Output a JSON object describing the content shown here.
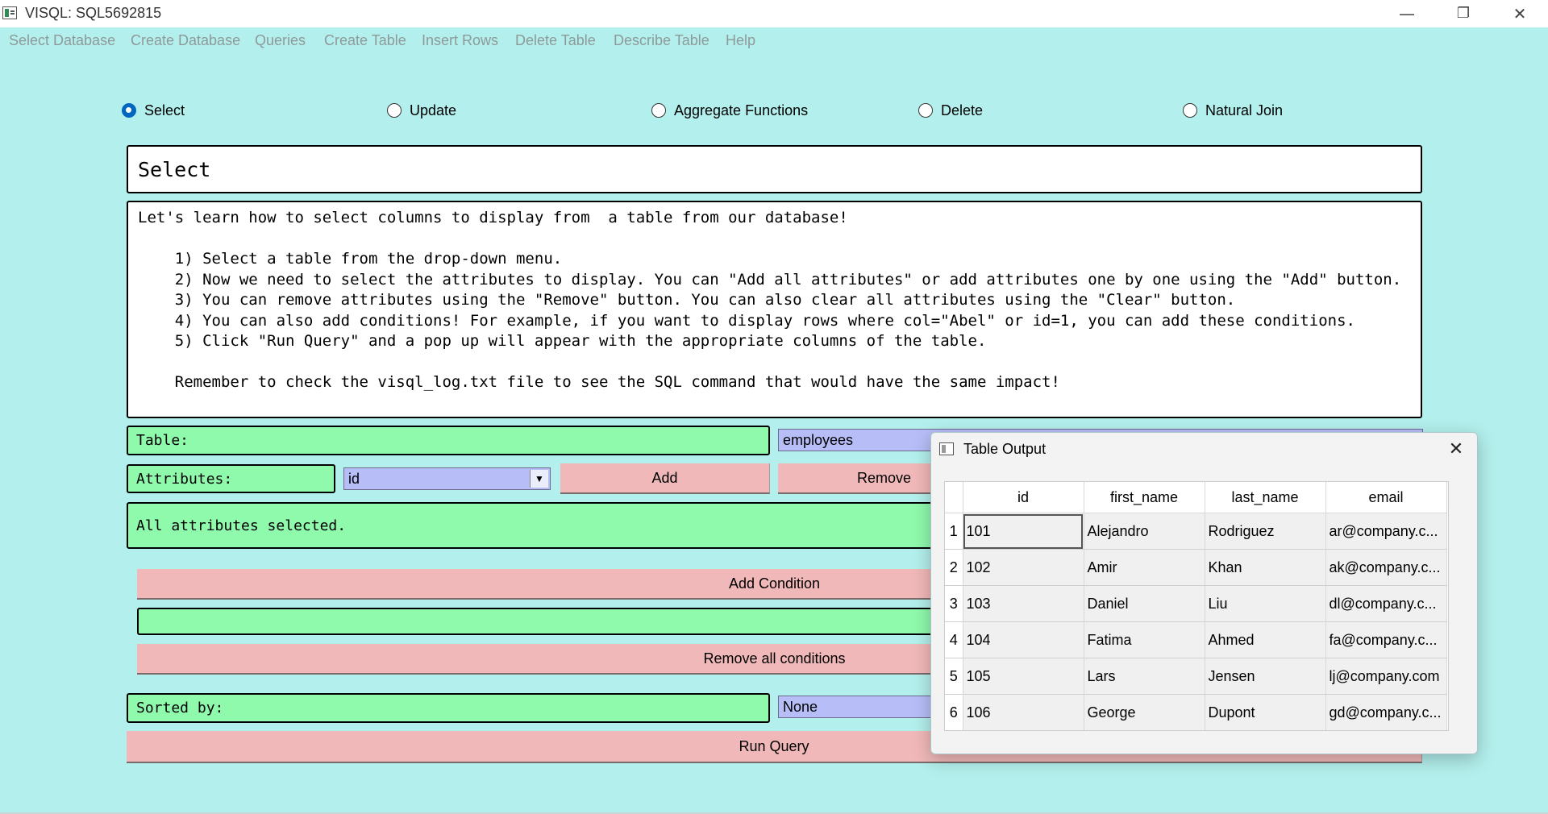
{
  "window": {
    "title": "VISQL: SQL5692815",
    "minimize": "—",
    "maximize": "❐",
    "close": "✕"
  },
  "menu": [
    "Select Database",
    "Create Database",
    "Queries",
    "Create Table",
    "Insert Rows",
    "Delete Table",
    "Describe Table",
    "Help"
  ],
  "modes": {
    "selected": "Select",
    "options": [
      "Select",
      "Update",
      "Aggregate Functions",
      "Delete",
      "Natural Join"
    ]
  },
  "heading": "Select",
  "description": "Let's learn how to select columns to display from  a table from our database!\n\n    1) Select a table from the drop-down menu.\n    2) Now we need to select the attributes to display. You can \"Add all attributes\" or add attributes one by one using the \"Add\" button.\n    3) You can remove attributes using the \"Remove\" button. You can also clear all attributes using the \"Clear\" button.\n    4) You can also add conditions! For example, if you want to display rows where col=\"Abel\" or id=1, you can add these conditions.\n    5) Click \"Run Query\" and a pop up will appear with the appropriate columns of the table.\n\n    Remember to check the visql_log.txt file to see the SQL command that would have the same impact!",
  "form": {
    "table_label": "Table:",
    "table_value": "employees",
    "attributes_label": "Attributes:",
    "attribute_value": "id",
    "add_label": "Add",
    "remove_label": "Remove",
    "status": "All attributes selected.",
    "add_condition_label": "Add Condition",
    "condition_value": "",
    "remove_conditions_label": "Remove all conditions",
    "sorted_label": "Sorted by:",
    "sorted_value": "None",
    "run_label": "Run Query"
  },
  "popup": {
    "title": "Table Output",
    "close": "✕",
    "columns": [
      "id",
      "first_name",
      "last_name",
      "email"
    ],
    "rows": [
      {
        "n": "1",
        "cells": [
          "101",
          "Alejandro",
          "Rodriguez",
          "ar@company.c..."
        ]
      },
      {
        "n": "2",
        "cells": [
          "102",
          "Amir",
          "Khan",
          "ak@company.c..."
        ]
      },
      {
        "n": "3",
        "cells": [
          "103",
          "Daniel",
          "Liu",
          "dl@company.c..."
        ]
      },
      {
        "n": "4",
        "cells": [
          "104",
          "Fatima",
          "Ahmed",
          "fa@company.c..."
        ]
      },
      {
        "n": "5",
        "cells": [
          "105",
          "Lars",
          "Jensen",
          "lj@company.com"
        ]
      },
      {
        "n": "6",
        "cells": [
          "106",
          "George",
          "Dupont",
          "gd@company.c..."
        ]
      }
    ]
  },
  "colors": {
    "background": "#b3efec",
    "field_green": "#8ff9ac",
    "button_pink": "#f0b8b8",
    "combo_blue": "#b7bdf7"
  }
}
